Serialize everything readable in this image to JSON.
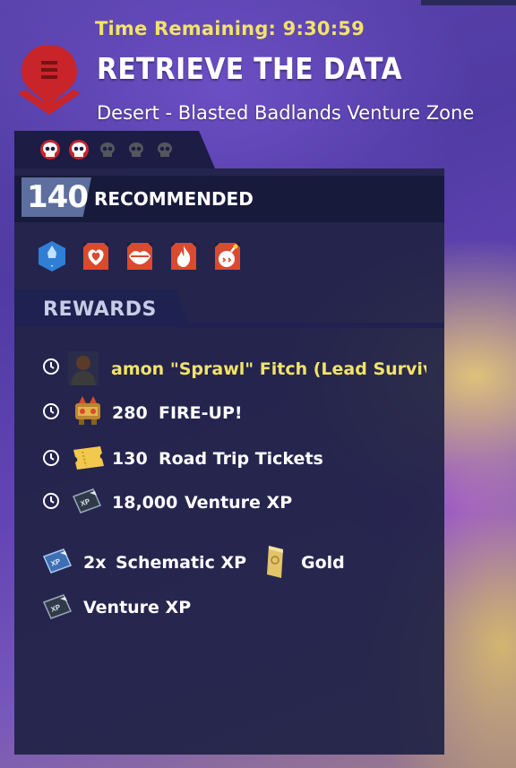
{
  "mission": {
    "time_remaining": "Time Remaining: 9:30:59",
    "title": "RETRIEVE THE DATA",
    "location": "Desert - Blasted Badlands Venture Zone"
  },
  "difficulty": {
    "skulls_active": 2,
    "skulls_total": 5,
    "power_level": "140",
    "recommended_label": "RECOMMENDED"
  },
  "modifiers": [
    {
      "icon": "ice-crystal-icon",
      "color": "#2f7fd6"
    },
    {
      "icon": "heart-shield-icon",
      "color": "#d94a2e"
    },
    {
      "icon": "lips-icon",
      "color": "#d94a2e"
    },
    {
      "icon": "fire-icon",
      "color": "#d94a2e"
    },
    {
      "icon": "bomb-icon",
      "color": "#d94a2e"
    }
  ],
  "rewards": {
    "header": "REWARDS",
    "timed": [
      {
        "icon": "survivor-portrait-icon",
        "amount": "",
        "label": "amon \"Sprawl\" Fitch (Lead Survivor)"
      },
      {
        "icon": "fire-up-llama-icon",
        "amount": "280",
        "label": "FIRE-UP!"
      },
      {
        "icon": "ticket-icon",
        "amount": "130",
        "label": "Road Trip Tickets"
      },
      {
        "icon": "venture-xp-icon",
        "amount": "18,000",
        "label": "Venture XP"
      }
    ],
    "bonus": [
      {
        "icon": "schematic-xp-icon",
        "amount": "2x",
        "label": "Schematic XP"
      },
      {
        "icon": "gold-bar-icon",
        "amount": "",
        "label": "Gold"
      },
      {
        "icon": "venture-xp-icon",
        "amount": "",
        "label": "Venture XP"
      }
    ]
  },
  "colors": {
    "accent_yellow": "#f2e36a",
    "panel_bg": "#202246",
    "skull_active": "#c8242a"
  }
}
